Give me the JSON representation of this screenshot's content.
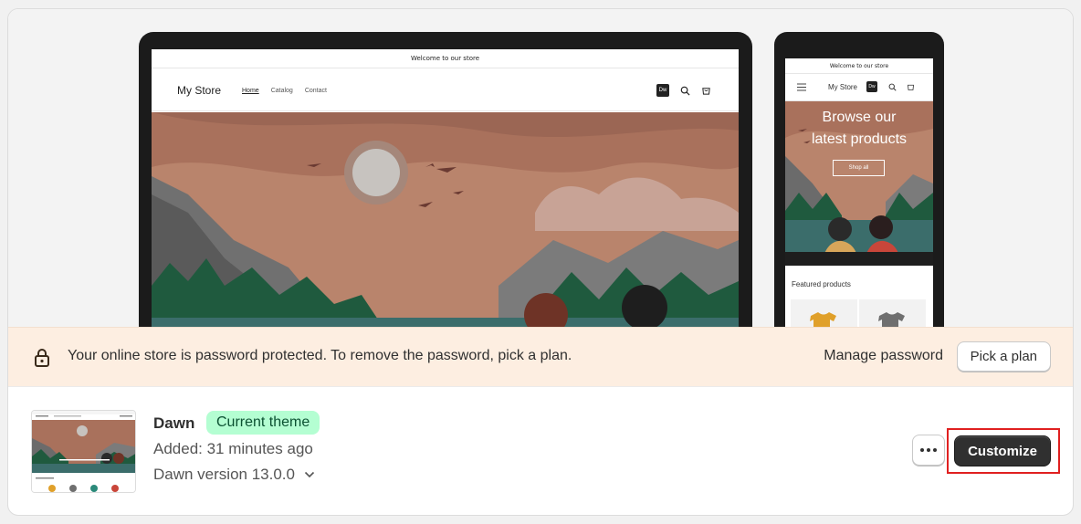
{
  "preview": {
    "desktop": {
      "announcement": "Welcome to our store",
      "logo": "My Store",
      "nav": [
        "Home",
        "Catalog",
        "Contact"
      ],
      "badge": "Dw",
      "icons": [
        "search-icon",
        "cart-icon"
      ]
    },
    "mobile": {
      "announcement": "Welcome to our store",
      "logo": "My Store",
      "badge": "Dw",
      "hero_title_line1": "Browse our",
      "hero_title_line2": "latest products",
      "hero_button": "Shop all",
      "featured_heading": "Featured products",
      "icons": [
        "menu-icon",
        "search-icon",
        "cart-icon"
      ]
    }
  },
  "banner": {
    "message": "Your online store is password protected. To remove the password, pick a plan.",
    "manage_password": "Manage password",
    "pick_plan": "Pick a plan",
    "background": "#fdeee1"
  },
  "theme": {
    "name": "Dawn",
    "badge": "Current theme",
    "badge_color": "#b4fed2",
    "added": "Added: 31 minutes ago",
    "version": "Dawn version 13.0.0",
    "customize": "Customize"
  }
}
